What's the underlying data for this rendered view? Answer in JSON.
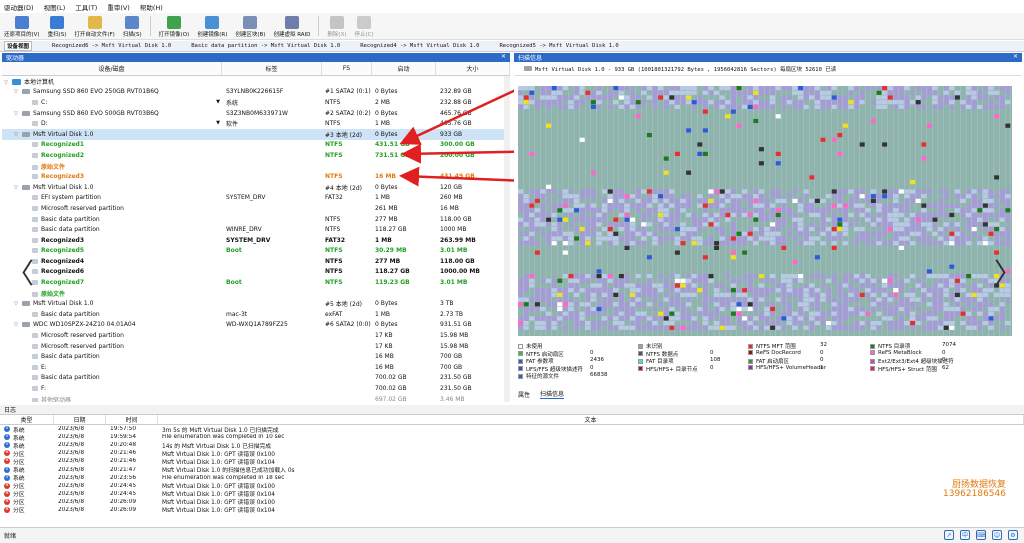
{
  "menu": [
    "驱动器(D)",
    "视图(L)",
    "工具(T)",
    "重审(V)",
    "帮助(H)"
  ],
  "toolbar": {
    "buttons": [
      {
        "label": "还原项目的(V)",
        "icon": "save-disk-icon",
        "color": "#4a7fd4",
        "disabled": false
      },
      {
        "label": "重扫(S)",
        "icon": "refresh-icon",
        "color": "#3a7bd5",
        "disabled": false
      },
      {
        "label": "打开自动文件(F)",
        "icon": "folder-icon",
        "color": "#e2b84a",
        "disabled": false
      },
      {
        "label": "扫描(S)",
        "icon": "scan-icon",
        "color": "#5b88c9",
        "disabled": false
      },
      {
        "label": "打开镜像(O)",
        "icon": "open-image-icon",
        "color": "#3fa34d",
        "disabled": false
      },
      {
        "label": "创建镜像(R)",
        "icon": "create-image-icon",
        "color": "#4b8fd6",
        "disabled": false
      },
      {
        "label": "创建区块(B)",
        "icon": "block-icon",
        "color": "#7a8fb3",
        "disabled": false
      },
      {
        "label": "创建虚拟 RAID",
        "icon": "raid-icon",
        "color": "#6d7fa8",
        "disabled": false
      },
      {
        "label": "删除(X)",
        "icon": "delete-icon",
        "color": "#888888",
        "disabled": true
      },
      {
        "label": "停止(C)",
        "icon": "stop-icon",
        "color": "#999999",
        "disabled": true
      }
    ]
  },
  "tabs": [
    "设备视图",
    "Recognized6 -> Msft Virtual Disk 1.0",
    "Basic data partition -> Msft Virtual Disk 1.0",
    "Recognized4 -> Msft Virtual Disk 1.0",
    "Recognized5 -> Msft Virtual Disk 1.0"
  ],
  "left_panel": {
    "title": "驱动器",
    "columns": [
      "设备/磁盘",
      "标签",
      "FS",
      "启动",
      "大小"
    ],
    "rows": [
      {
        "indent": 0,
        "expander": "▽",
        "icon": "pc",
        "name": "本地计算机",
        "label": "",
        "fs": "",
        "start": "",
        "size": "",
        "style": ""
      },
      {
        "indent": 1,
        "expander": "▽",
        "icon": "disk",
        "name": "Samsung SSD 860 EVO 250GB RVT01B6Q",
        "label": "S3YLNB0K226615F",
        "fs": "#1 SATA2 (0:1)",
        "start": "0 Bytes",
        "size": "232.89 GB",
        "style": ""
      },
      {
        "indent": 2,
        "expander": "",
        "icon": "part",
        "name": "C:",
        "label": "系统",
        "fs": "NTFS",
        "start": "2 MB",
        "size": "232.88 GB",
        "style": "",
        "dropdown": true
      },
      {
        "indent": 1,
        "expander": "▽",
        "icon": "disk",
        "name": "Samsung SSD 860 EVO 500GB RVT03B6Q",
        "label": "S3Z3NB0M633971W",
        "fs": "#2 SATA2 (0:2)",
        "start": "0 Bytes",
        "size": "465.76 GB",
        "style": ""
      },
      {
        "indent": 2,
        "expander": "",
        "icon": "part",
        "name": "D:",
        "label": "软件",
        "fs": "NTFS",
        "start": "1 MB",
        "size": "465.76 GB",
        "style": "",
        "dropdown": true
      },
      {
        "indent": 1,
        "expander": "▽",
        "icon": "disk",
        "name": "Msft Virtual Disk 1.0",
        "label": "",
        "fs": "#3 本地 (2d)",
        "start": "0 Bytes",
        "size": "933 GB",
        "style": "sel"
      },
      {
        "indent": 2,
        "expander": "",
        "icon": "part",
        "name": "Recognized1",
        "label": "",
        "fs": "NTFS",
        "start": "431.51 GB",
        "size": "300.00 GB",
        "style": "green"
      },
      {
        "indent": 2,
        "expander": "",
        "icon": "part",
        "name": "Recognized2",
        "label": "",
        "fs": "NTFS",
        "start": "731.51 GB",
        "size": "200.00 GB",
        "style": "green"
      },
      {
        "indent": 2,
        "expander": "",
        "icon": "part",
        "name": "原始文件",
        "label": "",
        "fs": "",
        "start": "",
        "size": "",
        "style": "orange"
      },
      {
        "indent": 2,
        "expander": "",
        "icon": "part",
        "name": "Recognized3",
        "label": "",
        "fs": "NTFS",
        "start": "16 MB",
        "size": "431.49 GB",
        "style": "orange"
      },
      {
        "indent": 1,
        "expander": "▽",
        "icon": "disk",
        "name": "Msft Virtual Disk 1.0",
        "label": "",
        "fs": "#4 本地 (2d)",
        "start": "0 Bytes",
        "size": "120 GB",
        "style": ""
      },
      {
        "indent": 2,
        "expander": "",
        "icon": "part",
        "name": "EFI system partition",
        "label": "SYSTEM_DRV",
        "fs": "FAT32",
        "start": "1 MB",
        "size": "260 MB",
        "style": ""
      },
      {
        "indent": 2,
        "expander": "",
        "icon": "part",
        "name": "Microsoft reserved partition",
        "label": "",
        "fs": "",
        "start": "261 MB",
        "size": "16 MB",
        "style": ""
      },
      {
        "indent": 2,
        "expander": "",
        "icon": "part",
        "name": "Basic data partition",
        "label": "",
        "fs": "NTFS",
        "start": "277 MB",
        "size": "118.00 GB",
        "style": ""
      },
      {
        "indent": 2,
        "expander": "",
        "icon": "part",
        "name": "Basic data partition",
        "label": "WINRE_DRV",
        "fs": "NTFS",
        "start": "118.27 GB",
        "size": "1000 MB",
        "style": ""
      },
      {
        "indent": 2,
        "expander": "",
        "icon": "part",
        "name": "Recognized3",
        "label": "SYSTEM_DRV",
        "fs": "FAT32",
        "start": "1 MB",
        "size": "263.99 MB",
        "style": "bold"
      },
      {
        "indent": 2,
        "expander": "",
        "icon": "part",
        "name": "Recognized5",
        "label": "Boot",
        "fs": "NTFS",
        "start": "30.29 MB",
        "size": "3.01 MB",
        "style": "green"
      },
      {
        "indent": 2,
        "expander": "",
        "icon": "part",
        "name": "Recognized4",
        "label": "",
        "fs": "NTFS",
        "start": "277 MB",
        "size": "118.00 GB",
        "style": "bold"
      },
      {
        "indent": 2,
        "expander": "",
        "icon": "part",
        "name": "Recognized6",
        "label": "",
        "fs": "NTFS",
        "start": "118.27 GB",
        "size": "1000.00 MB",
        "style": "bold"
      },
      {
        "indent": 2,
        "expander": "",
        "icon": "part",
        "name": "Recognized7",
        "label": "Boot",
        "fs": "NTFS",
        "start": "119.23 GB",
        "size": "3.01 MB",
        "style": "green"
      },
      {
        "indent": 2,
        "expander": "",
        "icon": "part",
        "name": "原始文件",
        "label": "",
        "fs": "",
        "start": "",
        "size": "",
        "style": "green"
      },
      {
        "indent": 1,
        "expander": "▽",
        "icon": "disk",
        "name": "Msft Virtual Disk 1.0",
        "label": "",
        "fs": "#5 本地 (2d)",
        "start": "0 Bytes",
        "size": "3 TB",
        "style": ""
      },
      {
        "indent": 2,
        "expander": "",
        "icon": "part",
        "name": "Basic data partition",
        "label": "mac-3t",
        "fs": "exFAT",
        "start": "1 MB",
        "size": "2.73 TB",
        "style": ""
      },
      {
        "indent": 1,
        "expander": "▽",
        "icon": "disk",
        "name": "WDC WD10SPZX-24Z10 04.01A04",
        "label": "WD-WXQ1A789FZ25",
        "fs": "#6 SATA2 (0:0)",
        "start": "0 Bytes",
        "size": "931.51 GB",
        "style": ""
      },
      {
        "indent": 2,
        "expander": "",
        "icon": "part",
        "name": "Microsoft reserved partition",
        "label": "",
        "fs": "",
        "start": "17 KB",
        "size": "15.98 MB",
        "style": ""
      },
      {
        "indent": 2,
        "expander": "",
        "icon": "part",
        "name": "Microsoft reserved partition",
        "label": "",
        "fs": "",
        "start": "17 KB",
        "size": "15.98 MB",
        "style": ""
      },
      {
        "indent": 2,
        "expander": "",
        "icon": "part",
        "name": "Basic data partition",
        "label": "",
        "fs": "",
        "start": "16 MB",
        "size": "700 GB",
        "style": ""
      },
      {
        "indent": 2,
        "expander": "",
        "icon": "part",
        "name": "E:",
        "label": "",
        "fs": "",
        "start": "16 MB",
        "size": "700 GB",
        "style": ""
      },
      {
        "indent": 2,
        "expander": "",
        "icon": "part",
        "name": "Basic data partition",
        "label": "",
        "fs": "",
        "start": "700.02 GB",
        "size": "231.50 GB",
        "style": ""
      },
      {
        "indent": 2,
        "expander": "",
        "icon": "part",
        "name": "F:",
        "label": "",
        "fs": "",
        "start": "700.02 GB",
        "size": "231.50 GB",
        "style": ""
      },
      {
        "indent": 2,
        "expander": "",
        "icon": "part",
        "name": "其他驱动器",
        "label": "",
        "fs": "",
        "start": "697.02 GB",
        "size": "3.46 MB",
        "style": "dim"
      }
    ]
  },
  "right_panel": {
    "title": "扫描信息",
    "disk_info": "Msft Virtual Disk 1.0 - 933 GB (1001801321792 Bytes , 1956042816 Sectors) 每扇区块 52610 已读",
    "legend": [
      {
        "label": "未使用",
        "color": "#ffffff",
        "count": ""
      },
      {
        "label": "未识别",
        "color": "#8da8a0",
        "count": ""
      },
      {
        "label": "NTFS MFT 范围",
        "color": "#e43030",
        "count": "32"
      },
      {
        "label": "NTFS 目录项",
        "color": "#1f7a1f",
        "count": "7074"
      },
      {
        "label": "NTFS 启动扇区",
        "color": "#4caf50",
        "count": "0"
      },
      {
        "label": "NTFS 数据点",
        "color": "#555555",
        "count": "0"
      },
      {
        "label": "ReFS DocRecord",
        "color": "#8b1a1a",
        "count": "0"
      },
      {
        "label": "ReFS MetaBlock",
        "color": "#ff66cc",
        "count": "0"
      },
      {
        "label": "FAT 参数项",
        "color": "#2d5bd8",
        "count": "2436"
      },
      {
        "label": "FAT 目录项",
        "color": "#44dddd",
        "count": "108"
      },
      {
        "label": "FAT 启动扇区",
        "color": "#2e9a48",
        "count": "0"
      },
      {
        "label": "Ext2/Ext3/Ext4 超级块描述符",
        "color": "#cc44cc",
        "count": "0"
      },
      {
        "label": "UFS/FFS 超级块描述符",
        "color": "#3355cc",
        "count": "0"
      },
      {
        "label": "HFS/HFS+ 目录节点",
        "color": "#a0145a",
        "count": "0"
      },
      {
        "label": "HFS/HFS+ VolumeHeader",
        "color": "#9c27b0",
        "count": "1"
      },
      {
        "label": "HFS/HFS+ Struct 范围",
        "color": "#e91e63",
        "count": "62"
      },
      {
        "label": "特征的源文件",
        "color": "#3366aa",
        "count": "66838"
      }
    ],
    "bottom_tabs": [
      "属性",
      "扫描信息"
    ]
  },
  "scan_map": {
    "base_color": "#8fb3ad",
    "light_color": "#b9c9e8",
    "purple_color": "#a79ad8"
  },
  "log": {
    "title": "日志",
    "columns": [
      "类型",
      "日期",
      "时间",
      "文本"
    ],
    "rows": [
      {
        "type": "系统",
        "kind": "info",
        "date": "2023/6/8",
        "time": "19:57:50",
        "text": "3m 5s 的 Msft Virtual Disk 1.0 已扫描完成"
      },
      {
        "type": "系统",
        "kind": "info",
        "date": "2023/6/8",
        "time": "19:59:54",
        "text": "File enumeration was completed in 10 sec"
      },
      {
        "type": "系统",
        "kind": "info",
        "date": "2023/6/8",
        "time": "20:20:48",
        "text": "14s 的 Msft Virtual Disk 1.0 已扫描完成"
      },
      {
        "type": "分区",
        "kind": "err",
        "date": "2023/6/8",
        "time": "20:21:46",
        "text": "Msft Virtual Disk 1.0: GPT 读错误 0x100"
      },
      {
        "type": "分区",
        "kind": "err",
        "date": "2023/6/8",
        "time": "20:21:46",
        "text": "Msft Virtual Disk 1.0: GPT 读错误 0x104"
      },
      {
        "type": "系统",
        "kind": "info",
        "date": "2023/6/8",
        "time": "20:21:47",
        "text": "Msft Virtual Disk 1.0 的扫描信息已成功加载入 0s"
      },
      {
        "type": "系统",
        "kind": "info",
        "date": "2023/6/8",
        "time": "20:23:56",
        "text": "File enumeration was completed in 18 sec"
      },
      {
        "type": "分区",
        "kind": "err",
        "date": "2023/6/8",
        "time": "20:24:45",
        "text": "Msft Virtual Disk 1.0: GPT 读错误 0x100"
      },
      {
        "type": "分区",
        "kind": "err",
        "date": "2023/6/8",
        "time": "20:24:45",
        "text": "Msft Virtual Disk 1.0: GPT 读错误 0x104"
      },
      {
        "type": "分区",
        "kind": "err",
        "date": "2023/6/8",
        "time": "20:26:09",
        "text": "Msft Virtual Disk 1.0: GPT 读错误 0x100"
      },
      {
        "type": "分区",
        "kind": "err",
        "date": "2023/6/8",
        "time": "20:26:09",
        "text": "Msft Virtual Disk 1.0: GPT 读错误 0x104"
      }
    ]
  },
  "watermark": {
    "line1": "厨扬数据恢复",
    "line2": "13962186546"
  },
  "status": {
    "text": "就绪"
  },
  "nav": {
    "prev": "〈",
    "next": "〉"
  }
}
